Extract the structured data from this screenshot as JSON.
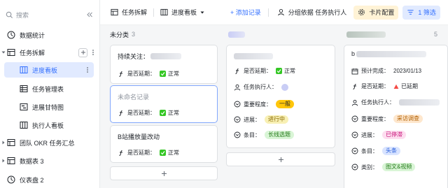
{
  "sidebar": {
    "search_placeholder": "搜索",
    "items": [
      {
        "label": "数据统计"
      },
      {
        "label": "任务拆解"
      },
      {
        "label": "进度看板"
      },
      {
        "label": "任务管理表"
      },
      {
        "label": "进展甘特图"
      },
      {
        "label": "执行人看板"
      },
      {
        "label": "团队 OKR 任务汇总"
      },
      {
        "label": "数据表 3"
      },
      {
        "label": "仪表盘 2"
      }
    ]
  },
  "toolbar": {
    "table_name": "任务拆解",
    "view_name": "进度看板",
    "add_record": "+ 添加记录",
    "group_by": "分组依据 任务执行人",
    "card_config": "卡片配置",
    "filter": "1 筛选"
  },
  "columns": [
    {
      "name": "未分类",
      "count": "3",
      "cards": [
        {
          "title": "持续关注：",
          "overdue_label": "是否延期：",
          "overdue_value": "正常"
        },
        {
          "title": "未命名记录",
          "overdue_label": "是否延期：",
          "overdue_value": "正常"
        },
        {
          "title": "B站播放量改动",
          "overdue_label": "是否延期：",
          "overdue_value": "正常"
        }
      ]
    },
    {
      "name": "",
      "count": "",
      "cards": [
        {
          "overdue_label": "是否延期：",
          "overdue_value": "正常",
          "assignee_label": "任务执行人：",
          "priority_label": "重要程度：",
          "priority_value": "一般",
          "progress_label": "进展：",
          "progress_value": "进行中",
          "entry_label": "条目：",
          "entry_value": "长线选题"
        }
      ]
    },
    {
      "name": "",
      "count": "5",
      "cards": [
        {
          "title": "b",
          "expected_label": "预计完成：",
          "expected_value": "2023/01/13",
          "overdue_label": "是否延期：",
          "overdue_value": "已延期",
          "assignee_label": "任务执行人：",
          "priority_label": "重要程度：",
          "priority_value": "采访调查",
          "progress_label": "进展：",
          "progress_value": "已停滞",
          "entry_label": "条目：",
          "entry_value": "头条",
          "category_label": "类别：",
          "category_value": "图文&视频"
        }
      ]
    }
  ],
  "colors": {
    "accent": "#3370ff",
    "ok_green": "#34c724",
    "tag_yellow": "#ffc60a",
    "tag_orange_bg": "#fee7cd",
    "tag_red_bg": "#fdddef",
    "tag_blue_bg": "#d9e4ff",
    "tag_green_bg": "#d9f5d6"
  }
}
